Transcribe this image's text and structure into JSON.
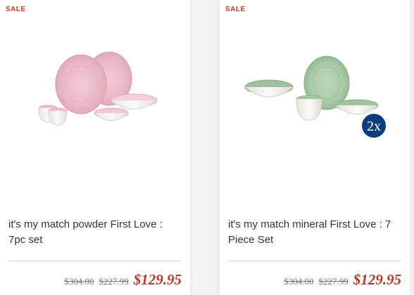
{
  "products": [
    {
      "badge": "SALE",
      "name": "it's my match powder First Love : 7pc set",
      "price_original": "$304.00",
      "price_previous": "$227.99",
      "price_sale": "$129.95",
      "image_icon": "pink-dinnerware-set-image",
      "colors": {
        "primary": "#e8b9c6",
        "accent": "#b13b2e"
      }
    },
    {
      "badge": "SALE",
      "name": "it's my match mineral First Love : 7 Piece Set",
      "price_original": "$304.00",
      "price_previous": "$227.99",
      "price_sale": "$129.95",
      "quantity_badge": "2x",
      "image_icon": "green-dinnerware-set-image",
      "colors": {
        "primary": "#a9cba8",
        "accent": "#0c3d7a"
      }
    }
  ]
}
